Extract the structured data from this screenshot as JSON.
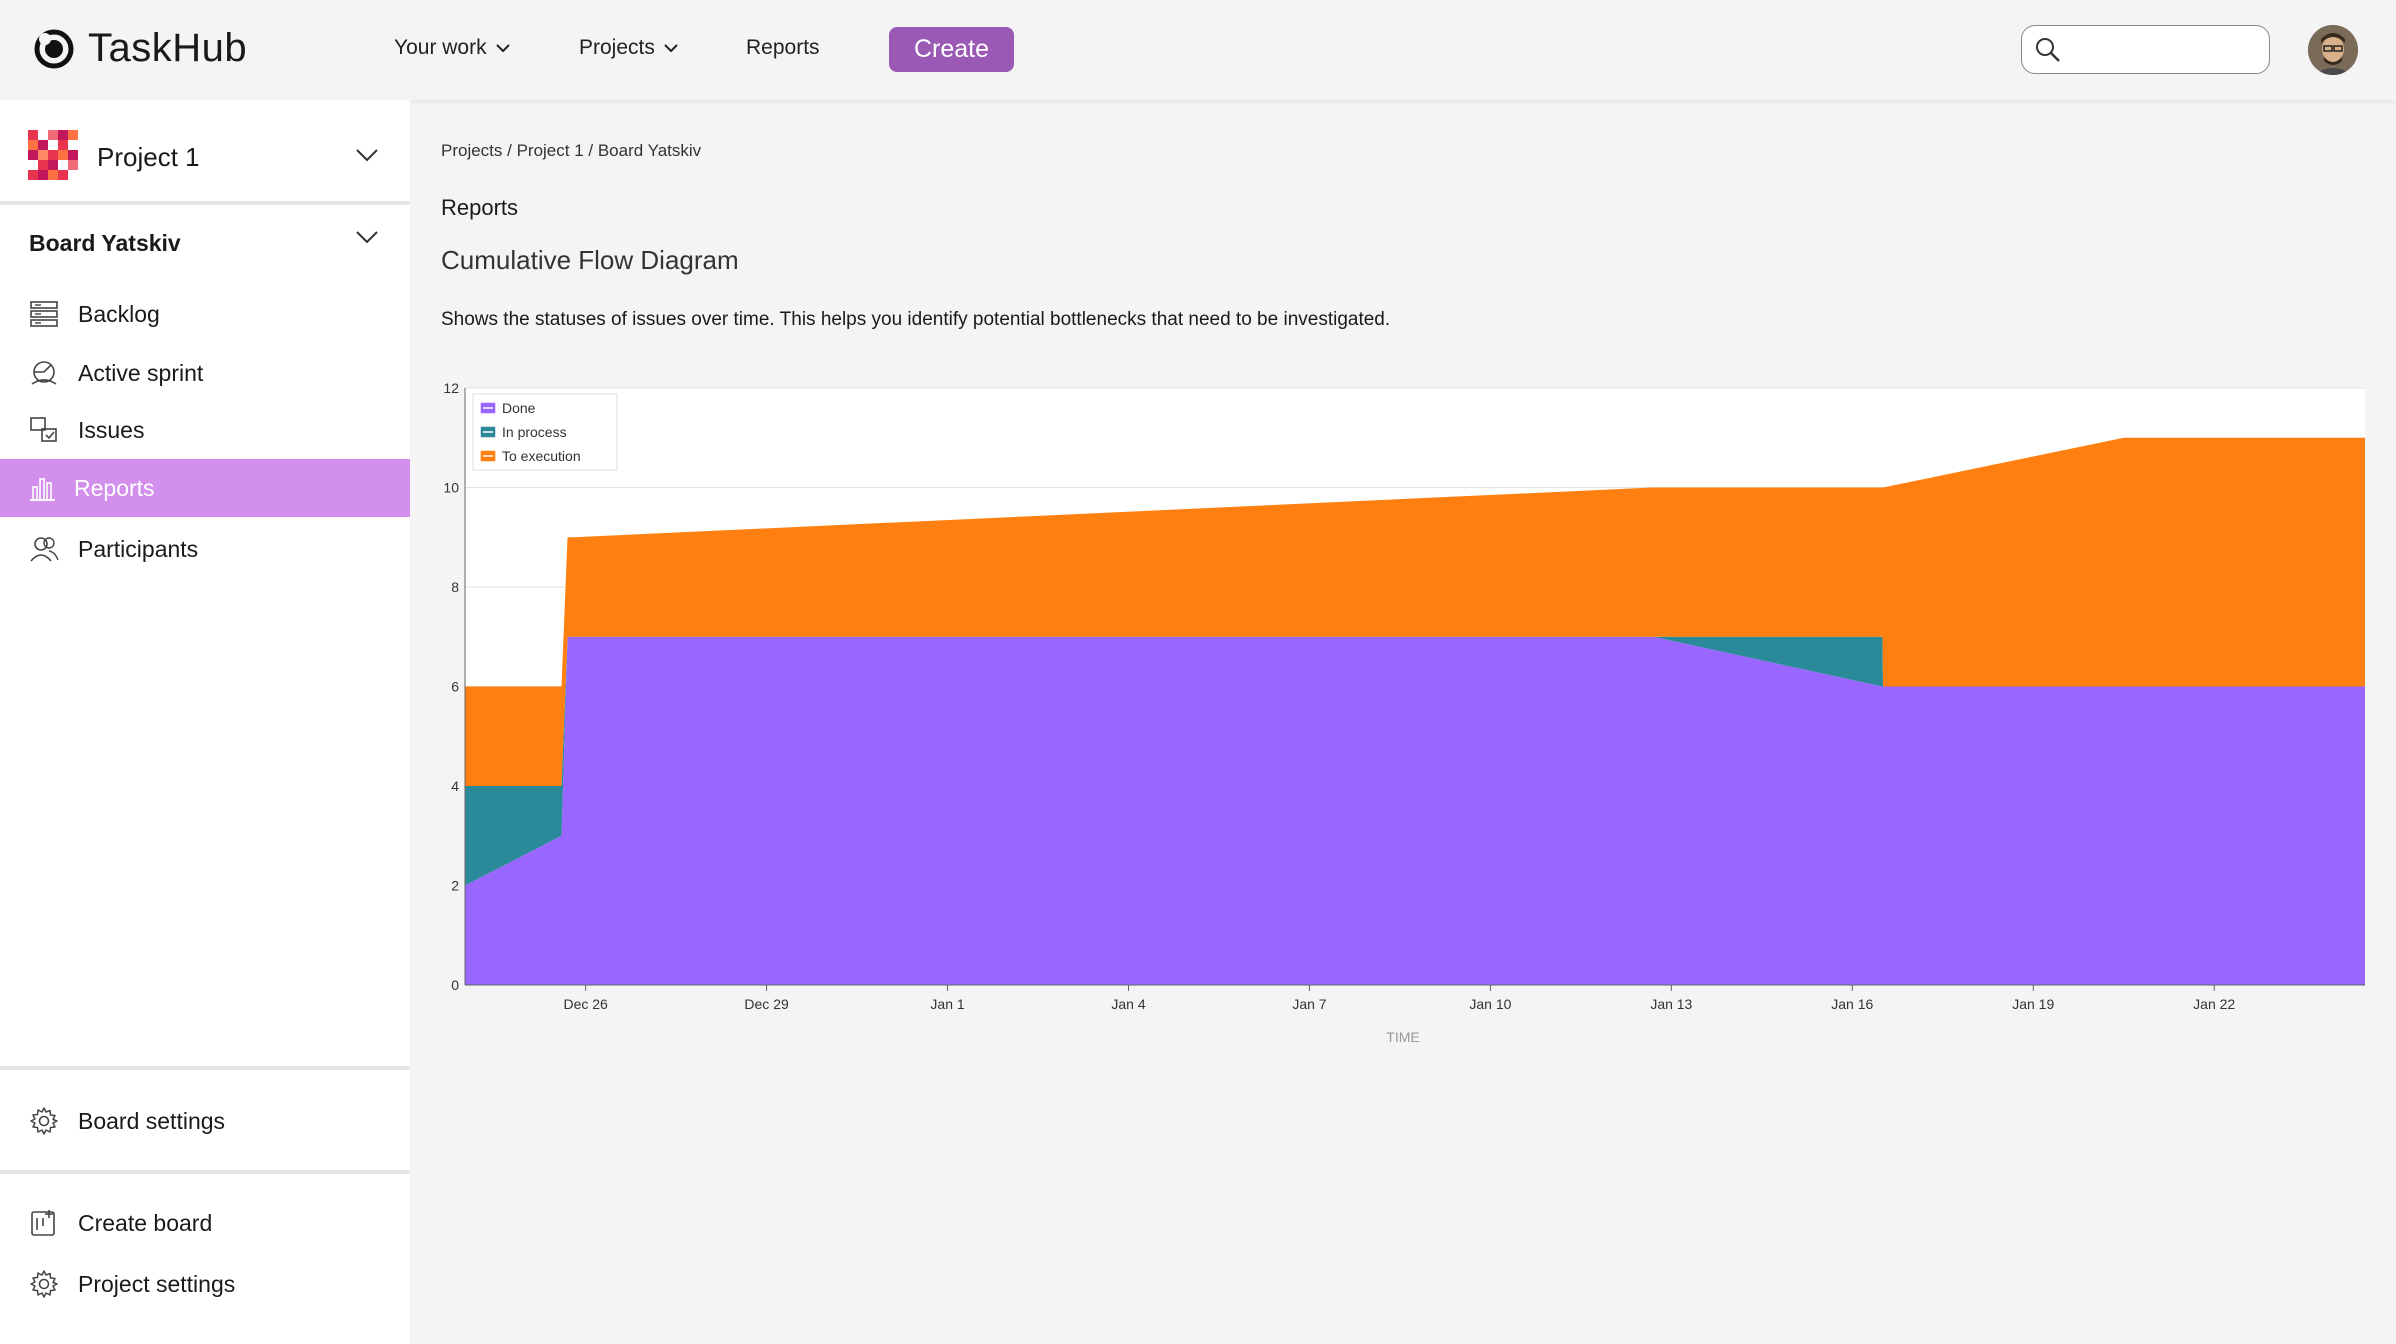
{
  "app": {
    "name": "TaskHub"
  },
  "nav": {
    "your_work": "Your work",
    "projects": "Projects",
    "reports": "Reports",
    "create": "Create"
  },
  "search": {
    "placeholder": ""
  },
  "sidebar": {
    "project_name": "Project 1",
    "board_name": "Board Yatskiv",
    "items": [
      {
        "label": "Backlog",
        "icon": "backlog-icon"
      },
      {
        "label": "Active sprint",
        "icon": "sprint-icon"
      },
      {
        "label": "Issues",
        "icon": "issues-icon"
      },
      {
        "label": "Reports",
        "icon": "reports-icon",
        "active": true
      },
      {
        "label": "Participants",
        "icon": "participants-icon"
      }
    ],
    "board_settings": "Board settings",
    "create_board": "Create board",
    "project_settings": "Project settings"
  },
  "main": {
    "breadcrumb": "Projects / Project 1 / Board Yatskiv",
    "section_title": "Reports",
    "chart_title": "Cumulative Flow Diagram",
    "description": "Shows the statuses of issues over time. This helps you identify potential bottlenecks that need to be investigated."
  },
  "chart_data": {
    "type": "area",
    "stacked": true,
    "xlabel": "TIME",
    "ylabel": "",
    "ylim": [
      0,
      12
    ],
    "yticks": [
      0,
      2,
      4,
      6,
      8,
      10,
      12
    ],
    "xticks": [
      "Dec 26",
      "Dec 29",
      "Jan 1",
      "Jan 4",
      "Jan 7",
      "Jan 10",
      "Jan 13",
      "Jan 16",
      "Jan 19",
      "Jan 22"
    ],
    "legend_position": "top-left",
    "grid": true,
    "x": [
      "Dec 24",
      "Dec 25.6",
      "Dec 25.7",
      "Dec 25.8",
      "Jan 12.7",
      "Jan 16.5",
      "Jan 16.5b",
      "Jan 20.5",
      "Jan 24.5"
    ],
    "x_days": [
      0,
      1.6,
      1.7,
      1.8,
      19.7,
      23.5,
      23.51,
      27.5,
      31.5
    ],
    "series": [
      {
        "name": "Done",
        "color": "#9966ff",
        "values": [
          2,
          3,
          7,
          7,
          7,
          6,
          6,
          6,
          6
        ]
      },
      {
        "name": "In process",
        "color": "#2a8a99",
        "values": [
          2,
          1,
          0,
          0,
          0,
          1,
          0,
          0,
          0
        ]
      },
      {
        "name": "To execution",
        "color": "#ff8011",
        "values": [
          2,
          2,
          2,
          2,
          3,
          3,
          4,
          5,
          5
        ]
      }
    ]
  }
}
